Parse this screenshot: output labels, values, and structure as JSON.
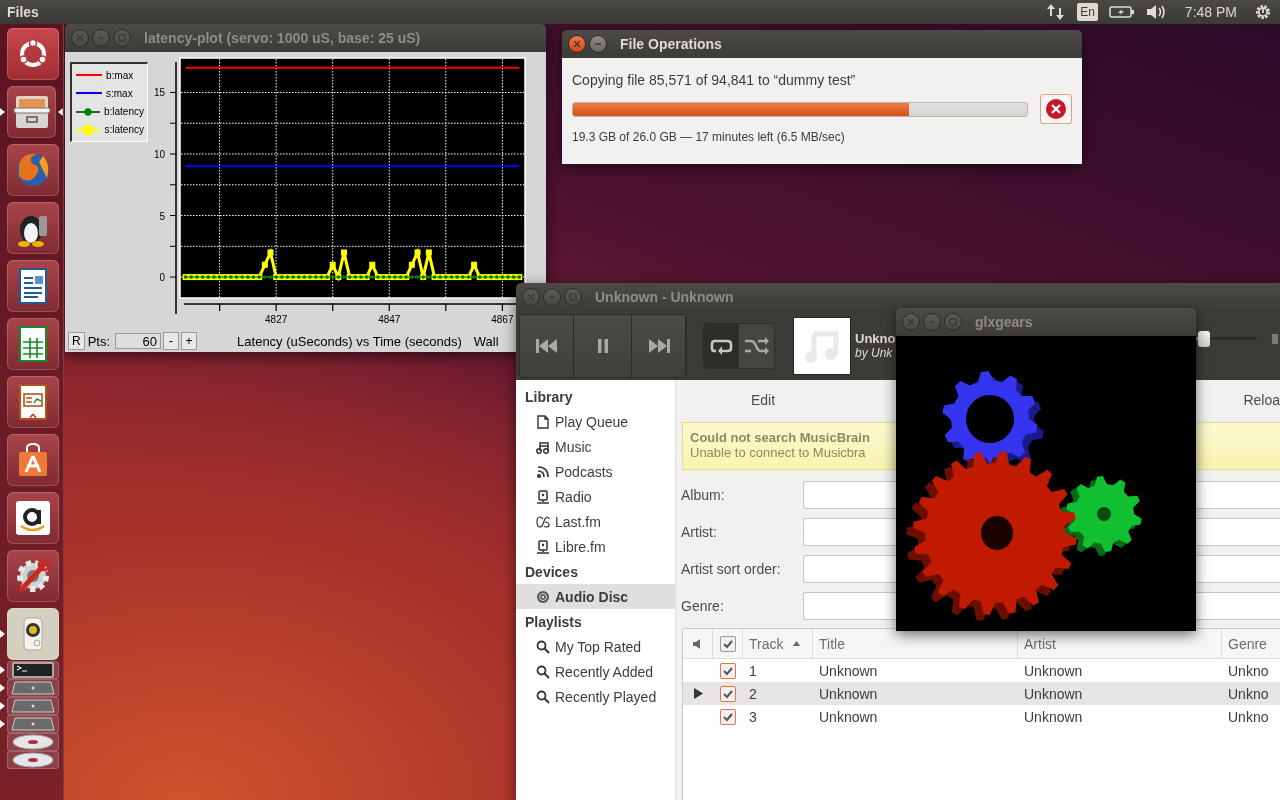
{
  "top_bar": {
    "app_name": "Files",
    "keyboard_layout": "En",
    "clock": "7:48 PM"
  },
  "launcher": {
    "items": [
      {
        "kind": "dash",
        "running": false,
        "focused": false,
        "collapsed": false
      },
      {
        "kind": "files",
        "running": true,
        "focused": true,
        "collapsed": false
      },
      {
        "kind": "browser",
        "running": false,
        "focused": false,
        "collapsed": false
      },
      {
        "kind": "penguin",
        "running": false,
        "focused": false,
        "collapsed": false
      },
      {
        "kind": "writer",
        "running": false,
        "focused": false,
        "collapsed": false
      },
      {
        "kind": "calc",
        "running": false,
        "focused": false,
        "collapsed": false
      },
      {
        "kind": "impress",
        "running": false,
        "focused": false,
        "collapsed": false
      },
      {
        "kind": "store",
        "running": false,
        "focused": false,
        "collapsed": false
      },
      {
        "kind": "amazon",
        "running": false,
        "focused": false,
        "collapsed": false
      },
      {
        "kind": "settings",
        "running": false,
        "focused": false,
        "collapsed": false
      },
      {
        "kind": "speaker",
        "running": true,
        "focused": false,
        "collapsed": false
      },
      {
        "kind": "terminal",
        "running": true,
        "focused": false,
        "collapsed": true
      },
      {
        "kind": "drive",
        "running": true,
        "focused": false,
        "collapsed": true
      },
      {
        "kind": "drive",
        "running": true,
        "focused": false,
        "collapsed": true
      },
      {
        "kind": "drive",
        "running": true,
        "focused": false,
        "collapsed": true
      },
      {
        "kind": "disc",
        "running": false,
        "focused": false,
        "collapsed": true
      },
      {
        "kind": "disc",
        "running": false,
        "focused": false,
        "collapsed": true
      }
    ]
  },
  "latency_window": {
    "title": "latency-plot (servo: 1000 uS, base: 25 uS)",
    "chart_data": {
      "type": "line",
      "grid": true,
      "xticks": [
        4827,
        4847,
        4867
      ],
      "yticks": [
        0,
        5,
        10,
        15
      ],
      "xlim": [
        4810,
        4871
      ],
      "ylim": [
        -1.7,
        17.8
      ],
      "x": [
        4811,
        4812,
        4813,
        4814,
        4815,
        4816,
        4817,
        4818,
        4819,
        4820,
        4821,
        4822,
        4823,
        4824,
        4825,
        4826,
        4827,
        4828,
        4829,
        4830,
        4831,
        4832,
        4833,
        4834,
        4835,
        4836,
        4837,
        4838,
        4839,
        4840,
        4841,
        4842,
        4843,
        4844,
        4845,
        4846,
        4847,
        4848,
        4849,
        4850,
        4851,
        4852,
        4853,
        4854,
        4855,
        4856,
        4857,
        4858,
        4859,
        4860,
        4861,
        4862,
        4863,
        4864,
        4865,
        4866,
        4867,
        4868,
        4869,
        4870
      ],
      "series": [
        {
          "name": "b:max",
          "color": "#ff0000",
          "values": [
            17,
            17,
            17,
            17,
            17,
            17,
            17,
            17,
            17,
            17,
            17,
            17,
            17,
            17,
            17,
            17,
            17,
            17,
            17,
            17,
            17,
            17,
            17,
            17,
            17,
            17,
            17,
            17,
            17,
            17,
            17,
            17,
            17,
            17,
            17,
            17,
            17,
            17,
            17,
            17,
            17,
            17,
            17,
            17,
            17,
            17,
            17,
            17,
            17,
            17,
            17,
            17,
            17,
            17,
            17,
            17,
            17,
            17,
            17,
            17
          ]
        },
        {
          "name": "s:max",
          "color": "#0000ff",
          "values": [
            9,
            9,
            9,
            9,
            9,
            9,
            9,
            9,
            9,
            9,
            9,
            9,
            9,
            9,
            9,
            9,
            9,
            9,
            9,
            9,
            9,
            9,
            9,
            9,
            9,
            9,
            9,
            9,
            9,
            9,
            9,
            9,
            9,
            9,
            9,
            9,
            9,
            9,
            9,
            9,
            9,
            9,
            9,
            9,
            9,
            9,
            9,
            9,
            9,
            9,
            9,
            9,
            9,
            9,
            9,
            9,
            9,
            9,
            9,
            9
          ]
        },
        {
          "name": "b:latency",
          "color": "#008000",
          "values": [
            0,
            0,
            0,
            0,
            0,
            0,
            0,
            0,
            0,
            0,
            0,
            0,
            0,
            0,
            0,
            0,
            0,
            0,
            0,
            0,
            0,
            0,
            0,
            0,
            0,
            0,
            0,
            0,
            0,
            0,
            0,
            0,
            0,
            0,
            0,
            0,
            0,
            0,
            0,
            0,
            0,
            0,
            0,
            0,
            0,
            0,
            0,
            0,
            0,
            0,
            0,
            0,
            0,
            0,
            0,
            0,
            0,
            0,
            0,
            0
          ]
        },
        {
          "name": "s:latency",
          "color": "#ffff00",
          "marker": "square",
          "values": [
            0,
            0,
            0,
            0,
            0,
            0,
            0,
            0,
            0,
            0,
            0,
            0,
            0,
            0,
            1,
            2,
            0,
            0,
            0,
            0,
            0,
            0,
            0,
            0,
            0,
            0,
            1,
            0,
            2,
            0,
            0,
            0,
            0,
            1,
            0,
            0,
            0,
            0,
            0,
            0,
            1,
            2,
            0,
            2,
            0,
            0,
            0,
            0,
            0,
            0,
            0,
            1,
            0,
            0,
            0,
            0,
            0,
            0,
            0,
            0
          ]
        }
      ]
    },
    "reset_button": "R",
    "points_label": "Pts:",
    "points_value": "60",
    "decrease_button": "-",
    "increase_button": "+",
    "caption": "Latency (uSeconds) vs Time (seconds)",
    "status": "Wall"
  },
  "file_operations": {
    "title": "File Operations",
    "message": "Copying file 85,571 of 94,841 to “dummy test”",
    "progress": {
      "level": 0.74
    },
    "details": "19.3 GB of 26.0 GB — 17 minutes left (6.5 MB/sec)"
  },
  "music_window": {
    "title": "Unknown - Unknown",
    "repeat": {
      "on": true
    },
    "shuffle": {
      "on": false
    },
    "now_playing": {
      "title": "Unkno",
      "artist_line": "by Unk"
    },
    "seek_slider": {
      "level": 0.79
    },
    "sidebar": [
      {
        "title": "Library",
        "items": [
          {
            "label": "Play Queue",
            "kind": "page",
            "selected": false
          },
          {
            "label": "Music",
            "kind": "note",
            "selected": false
          },
          {
            "label": "Podcasts",
            "kind": "feed",
            "selected": false
          },
          {
            "label": "Radio",
            "kind": "radio",
            "selected": false
          },
          {
            "label": "Last.fm",
            "kind": "logo",
            "selected": false
          },
          {
            "label": "Libre.fm",
            "kind": "radio",
            "selected": false
          }
        ]
      },
      {
        "title": "Devices",
        "items": [
          {
            "label": "Audio Disc",
            "kind": "disc",
            "selected": true
          }
        ]
      },
      {
        "title": "Playlists",
        "items": [
          {
            "label": "My Top Rated",
            "kind": "search",
            "selected": false
          },
          {
            "label": "Recently Added",
            "kind": "search",
            "selected": false
          },
          {
            "label": "Recently Played",
            "kind": "search",
            "selected": false
          }
        ]
      }
    ],
    "toolbar": [
      "Edit",
      "Reloa"
    ],
    "info_bar": {
      "title": "Could not search MusicBrain",
      "message": "Unable to connect to Musicbra"
    },
    "form": [
      {
        "label": "Album:"
      },
      {
        "label": "Artist:"
      },
      {
        "label": "Artist sort order:"
      },
      {
        "label": "Genre:"
      }
    ],
    "table": {
      "all_checked": true,
      "columns": [
        "Track",
        "Title",
        "Artist",
        "Genre"
      ],
      "rows": [
        {
          "track": "1",
          "title": "Unknown",
          "artist": "Unknown",
          "genre": "Unkno",
          "checked": true,
          "playing": false
        },
        {
          "track": "2",
          "title": "Unknown",
          "artist": "Unknown",
          "genre": "Unkno",
          "checked": true,
          "playing": true
        },
        {
          "track": "3",
          "title": "Unknown",
          "artist": "Unknown",
          "genre": "Unkno",
          "checked": true,
          "playing": false
        }
      ]
    }
  },
  "gears_window": {
    "title": "glxgears"
  }
}
